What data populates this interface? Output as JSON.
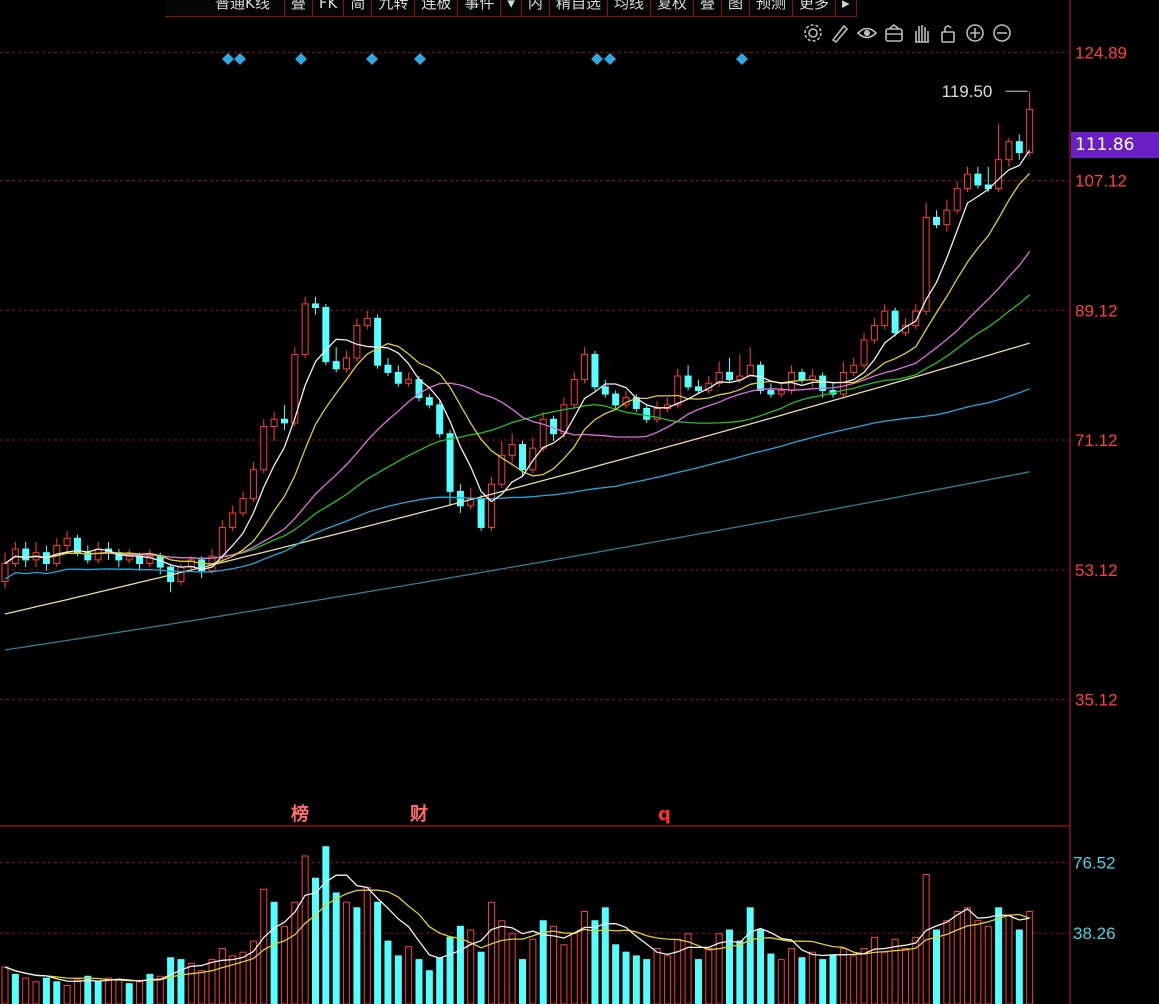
{
  "toolbar": {
    "items": [
      "普通K线",
      "叠",
      "FK",
      "简",
      "九转",
      "连板",
      "事件",
      "▾",
      "内",
      "精自选",
      "均线",
      "复权",
      "叠",
      "图",
      "预测",
      "更多",
      "▸"
    ]
  },
  "icons": [
    "gear-icon",
    "pen-icon",
    "eye-icon",
    "basket-icon",
    "hand-icon",
    "lock-icon",
    "zoom-in-icon",
    "zoom-out-icon"
  ],
  "price_axis": {
    "ticks": [
      "124.89",
      "107.12",
      "89.12",
      "71.12",
      "53.12",
      "35.12"
    ],
    "current": "111.86",
    "high_label": "119.50"
  },
  "volume_axis": {
    "ticks": [
      "76.52",
      "38.26"
    ]
  },
  "event_markers": [
    "榜",
    "财",
    "q"
  ],
  "colors": {
    "up": "#ff3b3b",
    "down": "#54ffff",
    "grid": "#8a1010",
    "axis_text": "#ff4040",
    "volume_axis_text": "#3fd9e6",
    "current_box": "#6a1fc2",
    "diamond": "#2fa8e0"
  },
  "chart_data": {
    "type": "candlestick",
    "price_ylim": [
      20,
      130
    ],
    "volume_ylim": [
      0,
      90
    ],
    "candles": [
      [
        51.5,
        54,
        55.5,
        50.5
      ],
      [
        54,
        56,
        57,
        53.5
      ],
      [
        56,
        54.5,
        57,
        53.5
      ],
      [
        54.5,
        55.5,
        57,
        53.5
      ],
      [
        55.5,
        54,
        56.5,
        53
      ],
      [
        54,
        56.5,
        57.5,
        53.5
      ],
      [
        56.5,
        57.5,
        58.5,
        55.5
      ],
      [
        57.5,
        55.5,
        58,
        55
      ],
      [
        55.5,
        54.5,
        56.5,
        54
      ],
      [
        54.5,
        56,
        57,
        54
      ],
      [
        56,
        55.5,
        57,
        54.5
      ],
      [
        55.5,
        54.5,
        56,
        53.5
      ],
      [
        54.5,
        55,
        56,
        54
      ],
      [
        55,
        54,
        55.5,
        53
      ],
      [
        54,
        55,
        56,
        53.5
      ],
      [
        55,
        53.5,
        55.5,
        52.5
      ],
      [
        53.5,
        51.5,
        54,
        50
      ],
      [
        51.5,
        53.5,
        54,
        51
      ],
      [
        53.5,
        54.5,
        55,
        53
      ],
      [
        54.5,
        53,
        55,
        52
      ],
      [
        53,
        55,
        56,
        52.5
      ],
      [
        55,
        59,
        60,
        54.5
      ],
      [
        59,
        61,
        62,
        58.5
      ],
      [
        61,
        63,
        64,
        60.5
      ],
      [
        63,
        67,
        68,
        62.5
      ],
      [
        67,
        73,
        74,
        66.5
      ],
      [
        73,
        74,
        75,
        71
      ],
      [
        74,
        73.5,
        76,
        72.5
      ],
      [
        73.5,
        83,
        84,
        73
      ],
      [
        83,
        90,
        91,
        82.5
      ],
      [
        90,
        89.5,
        91,
        88.5
      ],
      [
        89.5,
        82,
        90,
        81.5
      ],
      [
        82,
        81,
        84,
        80.5
      ],
      [
        81,
        82.5,
        83.5,
        80.5
      ],
      [
        82.5,
        87,
        88,
        82
      ],
      [
        87,
        88,
        89,
        86.5
      ],
      [
        88,
        81.5,
        88.5,
        81
      ],
      [
        81.5,
        80.5,
        82.5,
        80
      ],
      [
        80.5,
        79,
        81.5,
        78.5
      ],
      [
        79,
        79.5,
        80.5,
        78.5
      ],
      [
        79.5,
        77,
        80,
        76.5
      ],
      [
        77,
        76,
        77.5,
        75.5
      ],
      [
        76,
        72,
        76.5,
        71.5
      ],
      [
        72,
        64,
        72.5,
        62
      ],
      [
        64,
        62,
        65,
        61
      ],
      [
        62,
        63,
        64.5,
        61.5
      ],
      [
        63,
        59,
        63.5,
        58.5
      ],
      [
        59,
        65,
        66,
        58.5
      ],
      [
        65,
        69,
        71,
        64.5
      ],
      [
        69,
        70.5,
        72,
        68
      ],
      [
        70.5,
        67,
        71,
        66
      ],
      [
        67,
        70,
        71.5,
        66.5
      ],
      [
        70,
        74,
        75,
        69.5
      ],
      [
        74,
        72,
        74.5,
        71
      ],
      [
        72,
        76,
        77,
        71.5
      ],
      [
        76,
        79.5,
        80.5,
        75.5
      ],
      [
        79.5,
        83,
        84,
        79
      ],
      [
        83,
        78.5,
        83.5,
        78
      ],
      [
        78.5,
        77.5,
        79.5,
        77
      ],
      [
        77.5,
        76,
        78,
        75.5
      ],
      [
        76,
        77,
        78,
        75.5
      ],
      [
        77,
        75.5,
        77.5,
        75
      ],
      [
        75.5,
        74,
        76,
        73.5
      ],
      [
        74,
        75.5,
        76.5,
        73.5
      ],
      [
        75.5,
        76,
        77,
        75
      ],
      [
        76,
        80,
        81,
        75.5
      ],
      [
        80,
        78.5,
        81.5,
        78
      ],
      [
        78.5,
        78,
        79.5,
        77.5
      ],
      [
        78,
        79,
        80,
        77.5
      ],
      [
        79,
        80.5,
        82,
        78.5
      ],
      [
        80.5,
        79.5,
        82.5,
        79
      ],
      [
        79.5,
        80,
        83,
        79
      ],
      [
        80,
        81.5,
        84,
        80
      ],
      [
        81.5,
        78,
        82,
        77.5
      ],
      [
        78,
        77.5,
        79,
        77
      ],
      [
        77.5,
        78,
        79,
        77
      ],
      [
        78,
        80.5,
        81.5,
        77.5
      ],
      [
        80.5,
        79.5,
        81,
        79
      ],
      [
        79.5,
        80,
        81,
        78.5
      ],
      [
        80,
        78,
        80.5,
        77
      ],
      [
        78,
        77.5,
        79,
        77
      ],
      [
        77.5,
        80.5,
        82,
        77
      ],
      [
        80.5,
        81.5,
        82.5,
        80
      ],
      [
        81.5,
        85,
        86,
        81
      ],
      [
        85,
        87,
        88,
        84.5
      ],
      [
        87,
        89,
        90,
        86.5
      ],
      [
        89,
        86,
        89.5,
        85.5
      ],
      [
        86,
        87,
        88,
        85.5
      ],
      [
        87,
        89,
        90,
        86.5
      ],
      [
        89,
        102,
        104,
        88.5
      ],
      [
        102,
        101,
        103,
        100.5
      ],
      [
        101,
        103,
        104.5,
        100
      ],
      [
        103,
        106,
        107,
        102.5
      ],
      [
        106,
        108,
        109,
        105.5
      ],
      [
        108,
        106.5,
        109,
        106
      ],
      [
        106.5,
        106,
        109,
        105.5
      ],
      [
        106,
        110,
        115,
        105.5
      ],
      [
        110,
        112.5,
        113,
        109
      ],
      [
        112.5,
        111,
        113.5,
        110
      ],
      [
        111,
        117,
        119.5,
        110.5
      ]
    ],
    "volume": [
      [
        20,
        "u"
      ],
      [
        16,
        "d"
      ],
      [
        14,
        "u"
      ],
      [
        12,
        "u"
      ],
      [
        14,
        "d"
      ],
      [
        12,
        "d"
      ],
      [
        10,
        "u"
      ],
      [
        13,
        "u"
      ],
      [
        15,
        "d"
      ],
      [
        12,
        "d"
      ],
      [
        14,
        "u"
      ],
      [
        13,
        "u"
      ],
      [
        11,
        "d"
      ],
      [
        12,
        "u"
      ],
      [
        16,
        "d"
      ],
      [
        15,
        "u"
      ],
      [
        25,
        "d"
      ],
      [
        24,
        "d"
      ],
      [
        22,
        "u"
      ],
      [
        18,
        "u"
      ],
      [
        24,
        "u"
      ],
      [
        30,
        "u"
      ],
      [
        26,
        "u"
      ],
      [
        28,
        "u"
      ],
      [
        34,
        "u"
      ],
      [
        62,
        "u"
      ],
      [
        55,
        "d"
      ],
      [
        42,
        "u"
      ],
      [
        55,
        "u"
      ],
      [
        80,
        "u"
      ],
      [
        68,
        "d"
      ],
      [
        85,
        "d"
      ],
      [
        60,
        "d"
      ],
      [
        55,
        "u"
      ],
      [
        52,
        "d"
      ],
      [
        63,
        "u"
      ],
      [
        55,
        "d"
      ],
      [
        34,
        "d"
      ],
      [
        26,
        "d"
      ],
      [
        31,
        "u"
      ],
      [
        24,
        "d"
      ],
      [
        18,
        "d"
      ],
      [
        25,
        "d"
      ],
      [
        36,
        "d"
      ],
      [
        42,
        "d"
      ],
      [
        40,
        "u"
      ],
      [
        28,
        "d"
      ],
      [
        55,
        "u"
      ],
      [
        45,
        "u"
      ],
      [
        38,
        "u"
      ],
      [
        24,
        "d"
      ],
      [
        35,
        "u"
      ],
      [
        45,
        "d"
      ],
      [
        42,
        "u"
      ],
      [
        32,
        "u"
      ],
      [
        38,
        "u"
      ],
      [
        50,
        "u"
      ],
      [
        45,
        "d"
      ],
      [
        52,
        "d"
      ],
      [
        32,
        "d"
      ],
      [
        28,
        "d"
      ],
      [
        26,
        "d"
      ],
      [
        24,
        "d"
      ],
      [
        30,
        "u"
      ],
      [
        26,
        "u"
      ],
      [
        35,
        "u"
      ],
      [
        38,
        "u"
      ],
      [
        24,
        "d"
      ],
      [
        30,
        "u"
      ],
      [
        38,
        "u"
      ],
      [
        40,
        "d"
      ],
      [
        34,
        "d"
      ],
      [
        52,
        "d"
      ],
      [
        40,
        "d"
      ],
      [
        27,
        "d"
      ],
      [
        24,
        "u"
      ],
      [
        30,
        "u"
      ],
      [
        25,
        "d"
      ],
      [
        28,
        "u"
      ],
      [
        24,
        "d"
      ],
      [
        26,
        "d"
      ],
      [
        30,
        "u"
      ],
      [
        26,
        "u"
      ],
      [
        30,
        "u"
      ],
      [
        36,
        "u"
      ],
      [
        28,
        "u"
      ],
      [
        35,
        "u"
      ],
      [
        30,
        "u"
      ],
      [
        36,
        "u"
      ],
      [
        70,
        "u"
      ],
      [
        40,
        "d"
      ],
      [
        45,
        "u"
      ],
      [
        50,
        "u"
      ],
      [
        52,
        "u"
      ],
      [
        45,
        "u"
      ],
      [
        42,
        "u"
      ],
      [
        52,
        "d"
      ],
      [
        48,
        "u"
      ],
      [
        40,
        "d"
      ],
      [
        50,
        "u"
      ]
    ]
  }
}
